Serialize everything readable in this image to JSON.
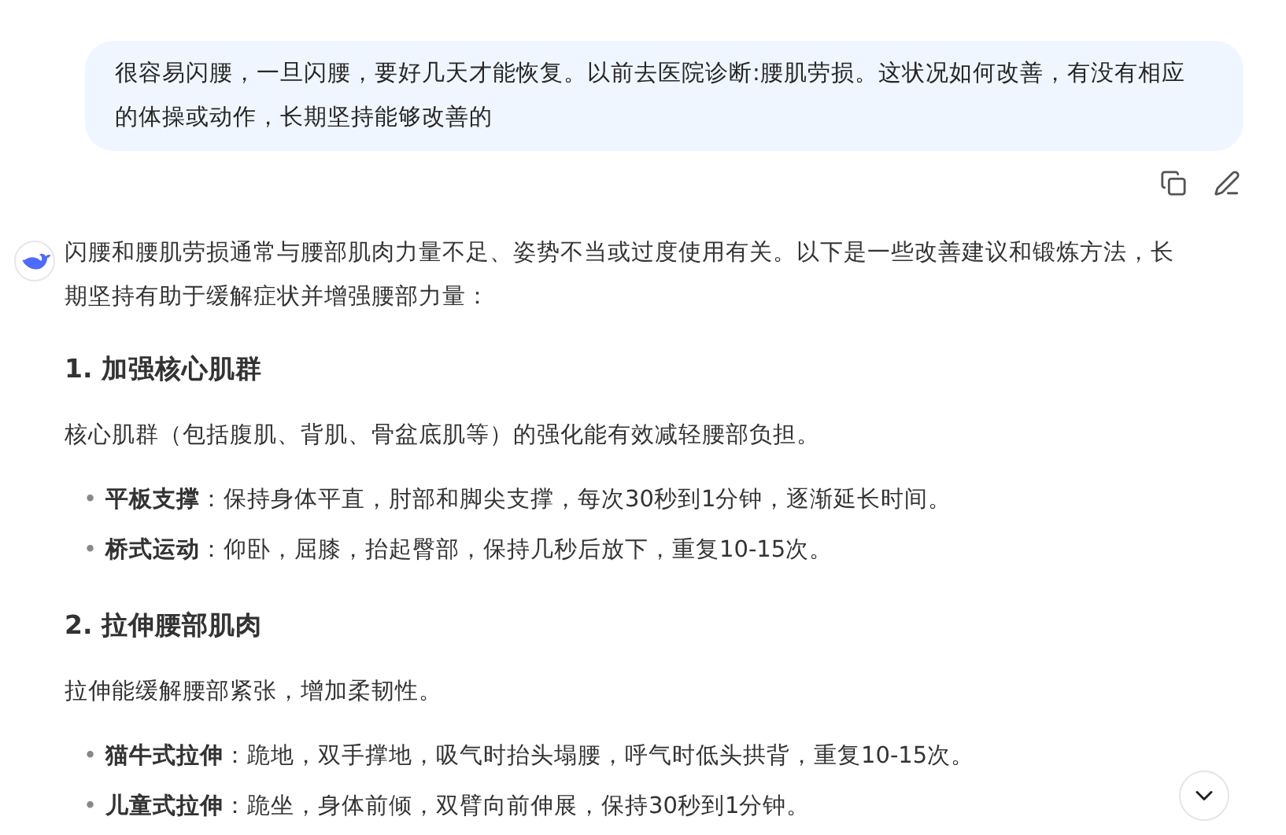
{
  "user_message": {
    "text": "很容易闪腰，一旦闪腰，要好几天才能恢复。以前去医院诊断:腰肌劳损。这状况如何改善，有没有相应的体操或动作，长期坚持能够改善的"
  },
  "answer": [
    {
      "kind": "paragraph",
      "text": "闪腰和腰肌劳损通常与腰部肌肉力量不足、姿势不当或过度使用有关。以下是一些改善建议和锻炼方法，长期坚持有助于缓解症状并增强腰部力量："
    },
    {
      "kind": "heading",
      "text": "1. 加强核心肌群"
    },
    {
      "kind": "paragraph",
      "text": "核心肌群（包括腹肌、背肌、骨盆底肌等）的强化能有效减轻腰部负担。"
    },
    {
      "kind": "bullets",
      "marker": "•",
      "items": [
        "**平板支撑**：保持身体平直，肘部和脚尖支撑，每次30秒到1分钟，逐渐延长时间。",
        "**桥式运动**：仰卧，屈膝，抬起臀部，保持几秒后放下，重复10-15次。"
      ]
    },
    {
      "kind": "heading",
      "text": "2. 拉伸腰部肌肉"
    },
    {
      "kind": "paragraph",
      "text": "拉伸能缓解腰部紧张，增加柔韧性。"
    },
    {
      "kind": "bullets",
      "marker": "•",
      "items": [
        "**猫牛式拉伸**：跪地，双手撑地，吸气时抬头塌腰，呼气时低头拱背，重复10-15次。",
        "**儿童式拉伸**：跪坐，身体前倾，双臂向前伸展，保持30秒到1分钟。"
      ]
    }
  ]
}
